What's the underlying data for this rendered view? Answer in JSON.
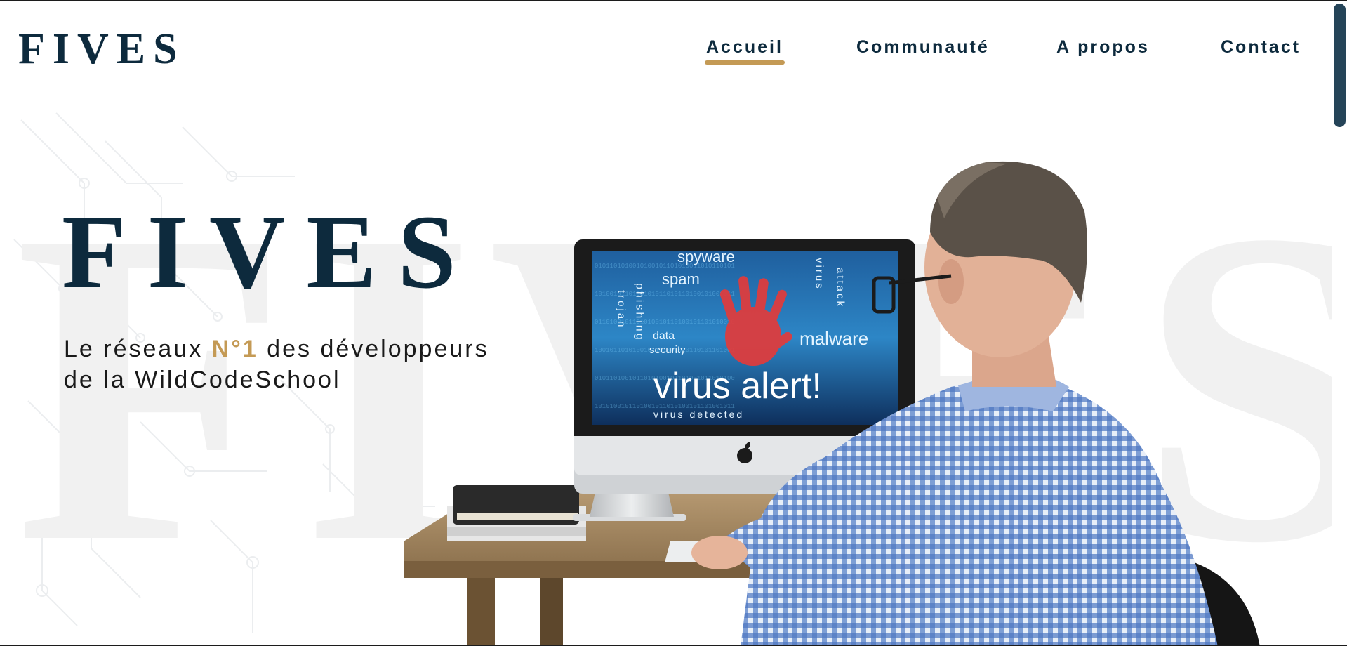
{
  "header": {
    "logo": "FIVES",
    "nav": [
      {
        "label": "Accueil",
        "active": true
      },
      {
        "label": "Communauté",
        "active": false
      },
      {
        "label": "A propos",
        "active": false
      },
      {
        "label": "Contact",
        "active": false
      }
    ]
  },
  "hero": {
    "title": "FIVES",
    "background_text": "FIVES",
    "tagline_before": "Le réseaux ",
    "tagline_accent": "N°1",
    "tagline_after": " des développeurs",
    "tagline_line2": "de la WildCodeSchool"
  },
  "illustration": {
    "screen_words": [
      "spyware",
      "spam",
      "phishing",
      "trojan",
      "data",
      "security",
      "virus",
      "attack",
      "malware",
      "virus alert!",
      "virus detected"
    ],
    "screen_text_large": "virus alert!",
    "screen_text_small": "virus detected"
  },
  "colors": {
    "navy": "#0d2a3d",
    "gold": "#c49a55",
    "scrollbar": "#254458"
  }
}
